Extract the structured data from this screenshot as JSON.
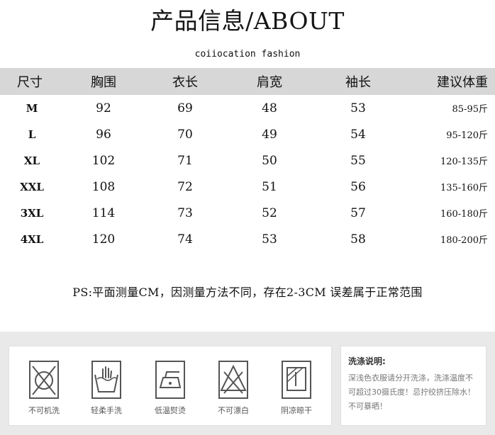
{
  "title": "产品信息/ABOUT",
  "subtitle": "coiiocation fashion",
  "table": {
    "headers": [
      "尺寸",
      "胸围",
      "衣长",
      "肩宽",
      "袖长",
      "建议体重"
    ],
    "rows": [
      [
        "M",
        "92",
        "69",
        "48",
        "53",
        "85-95斤"
      ],
      [
        "L",
        "96",
        "70",
        "49",
        "54",
        "95-120斤"
      ],
      [
        "XL",
        "102",
        "71",
        "50",
        "55",
        "120-135斤"
      ],
      [
        "XXL",
        "108",
        "72",
        "51",
        "56",
        "135-160斤"
      ],
      [
        "3XL",
        "114",
        "73",
        "52",
        "57",
        "160-180斤"
      ],
      [
        "4XL",
        "120",
        "74",
        "53",
        "58",
        "180-200斤"
      ]
    ]
  },
  "note": "PS:平面测量CM，因测量方法不同，存在2-3CM 误差属于正常范围",
  "care": {
    "icons": [
      {
        "icon": "no-machine-wash-icon",
        "label": "不可机洗"
      },
      {
        "icon": "hand-wash-icon",
        "label": "轻柔手洗"
      },
      {
        "icon": "low-temp-iron-icon",
        "label": "低温熨烫"
      },
      {
        "icon": "no-bleach-icon",
        "label": "不可漂白"
      },
      {
        "icon": "shade-dry-icon",
        "label": "阴凉晾干"
      }
    ],
    "wash_title": "洗涤说明:",
    "wash_text": "深浅色衣服请分开洗涤，洗涤温度不可超过30摄氏度！忌拧绞挤压除水！不可暴晒！"
  },
  "colors": {
    "header_bg": "#d7d7d7",
    "band_bg": "#e9e9e9",
    "icon_stroke": "#555555"
  }
}
